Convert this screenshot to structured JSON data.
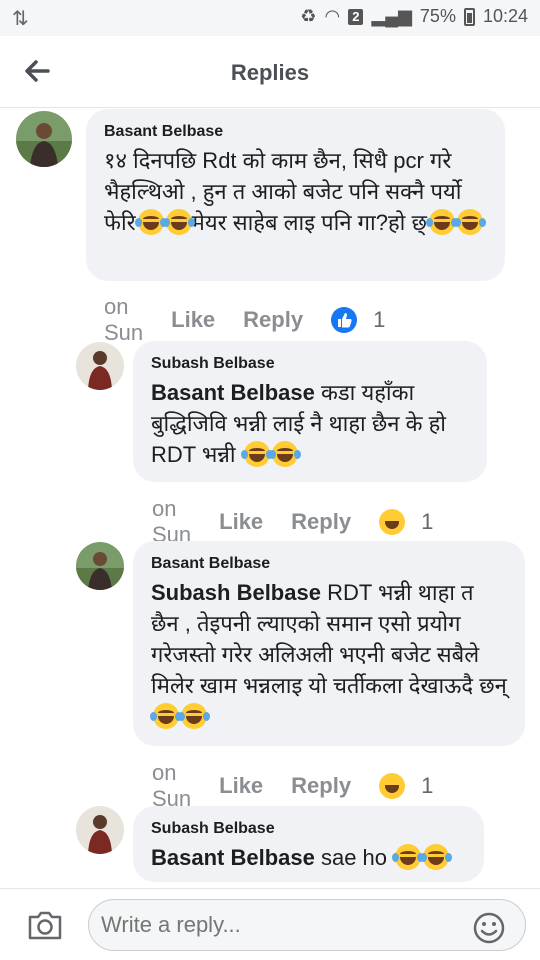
{
  "status_bar": {
    "battery_percent": "75%",
    "time": "10:24",
    "sim_badge": "2"
  },
  "header": {
    "title": "Replies"
  },
  "comments": [
    {
      "author": "Basant Belbase",
      "text": "१४ दिनपछि Rdt को काम छैन, सिधै pcr गरे भैहल्थिओ , हुन त आको बजेट पनि सक्नै पर्यो फेरि",
      "text_mid": "मेयर साहेब लाइ पनि गा?हो छ्",
      "time": "on Sun",
      "like_label": "Like",
      "reply_label": "Reply",
      "reaction": "like-icon",
      "reaction_count": "1"
    },
    {
      "author": "Subash Belbase",
      "mention": "Basant Belbase",
      "text": " कडा यहाँका बुद्धिजिवि भन्नी लाई नै थाहा छैन के हो RDT भन्नी",
      "time": "on Sun",
      "like_label": "Like",
      "reply_label": "Reply",
      "reaction": "haha-icon",
      "reaction_count": "1"
    },
    {
      "author": "Basant Belbase",
      "mention": "Subash Belbase",
      "text": " RDT भन्नी थाहा त छैन , तेइपनी ल्याएको समान एसो प्रयोग गरेजस्तो गरेर अलिअली भएनी बजेट सबैले मिलेर खाम भन्नलाइ यो चर्तीकला देखाऊदै छन्",
      "time": "on Sun",
      "like_label": "Like",
      "reply_label": "Reply",
      "reaction": "haha-icon",
      "reaction_count": "1"
    },
    {
      "author": "Subash Belbase",
      "mention": "Basant Belbase",
      "text": " sae ho"
    }
  ],
  "composer": {
    "placeholder": "Write a reply..."
  },
  "colors": {
    "accent": "#1877f2",
    "bubble": "#f0f2f5",
    "haha": "#ffcc33"
  }
}
